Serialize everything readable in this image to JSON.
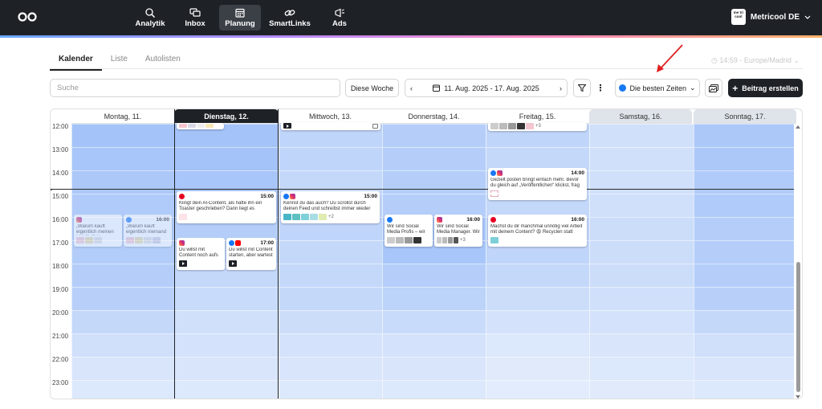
{
  "nav": {
    "items": [
      {
        "label": "Analytik",
        "icon": "analytics-icon"
      },
      {
        "label": "Inbox",
        "icon": "inbox-icon"
      },
      {
        "label": "Planung",
        "icon": "calendar-icon",
        "active": true
      },
      {
        "label": "SmartLinks",
        "icon": "link-icon"
      },
      {
        "label": "Ads",
        "icon": "megaphone-icon"
      }
    ],
    "account": {
      "avatar_text": "me tri cool",
      "name": "Metricool DE"
    }
  },
  "tabs": [
    "Kalender",
    "Liste",
    "Autolisten"
  ],
  "timezone": "14:59 - Europe/Madrid",
  "toolbar": {
    "search_placeholder": "Suche",
    "this_week": "Diese Woche",
    "date_range": "11. Aug. 2025 - 17. Aug. 2025",
    "best_times": "Die besten Zeiten",
    "create_post": "Beitrag erstellen"
  },
  "calendar": {
    "days": [
      "Montag, 11.",
      "Dienstag, 12.",
      "Mittwoch, 13.",
      "Donnerstag, 14.",
      "Freitag, 15.",
      "Samstag, 16.",
      "Sonntag, 17."
    ],
    "hours": [
      "12:00",
      "13:00",
      "14:00",
      "15:00",
      "16:00",
      "17:00",
      "18:00",
      "19:00",
      "20:00",
      "21:00",
      "22:00",
      "23:00"
    ],
    "posts": [
      {
        "day": 3,
        "time": "15:00",
        "text": "Klingt dein AI-Content, als hätte ihn ein Toaster geschrieben? Dann liegt es",
        "nets": [
          "pin"
        ]
      },
      {
        "day": 4,
        "time": "15:00",
        "text": "Kennst du das auch? Du scrollst durch deinen Feed und schreibst immer wieder dieselben",
        "nets": [
          "fb",
          "ig"
        ],
        "more": "+2"
      },
      {
        "day": 5,
        "time": "14:00",
        "text": "Gezielt posten bringt einfach mehr. Bevor du gleich auf „Veröffentlichen“ klickst, frag dich",
        "nets": [
          "fb",
          "ig"
        ]
      },
      {
        "day": 1,
        "time": "",
        "text": "„Warum kauft eigentlich meinen Link?“ 😅 Kon",
        "nets": [
          "ig"
        ]
      },
      {
        "day": 1,
        "time": "16:00",
        "text": "„Warum kauft eigentlich niemand",
        "nets": [
          "fb"
        ]
      },
      {
        "day": 4,
        "time": "",
        "text": "Wir sind Social Media Profis – wir retten nicht",
        "nets": [
          "fb"
        ]
      },
      {
        "day": 4,
        "time": "16:00",
        "text": "Wir sind Social Media Manager. Wir",
        "nets": [
          "ig"
        ],
        "more": "+3"
      },
      {
        "day": 5,
        "time": "16:00",
        "text": "Machst du dir manchmal unnötig viel Arbeit mit deinem Content? 😩 Recyclen statt",
        "nets": [
          "pin"
        ]
      },
      {
        "day": 2,
        "time": "",
        "text": "Du willst mit Content noch aufs perfekte Set",
        "nets": [
          "ig"
        ]
      },
      {
        "day": 2,
        "time": "17:00",
        "text": "Du willst mit Content starten, aber wartest",
        "nets": [
          "fb",
          "yt"
        ]
      }
    ],
    "top_partial": {
      "day2_more": "+3"
    }
  },
  "colors": {
    "nav_bg": "#1e2227",
    "accent_blue": "#9fc0f8",
    "facebook": "#1877f2",
    "pinterest": "#e60023",
    "youtube": "#ff0000"
  }
}
